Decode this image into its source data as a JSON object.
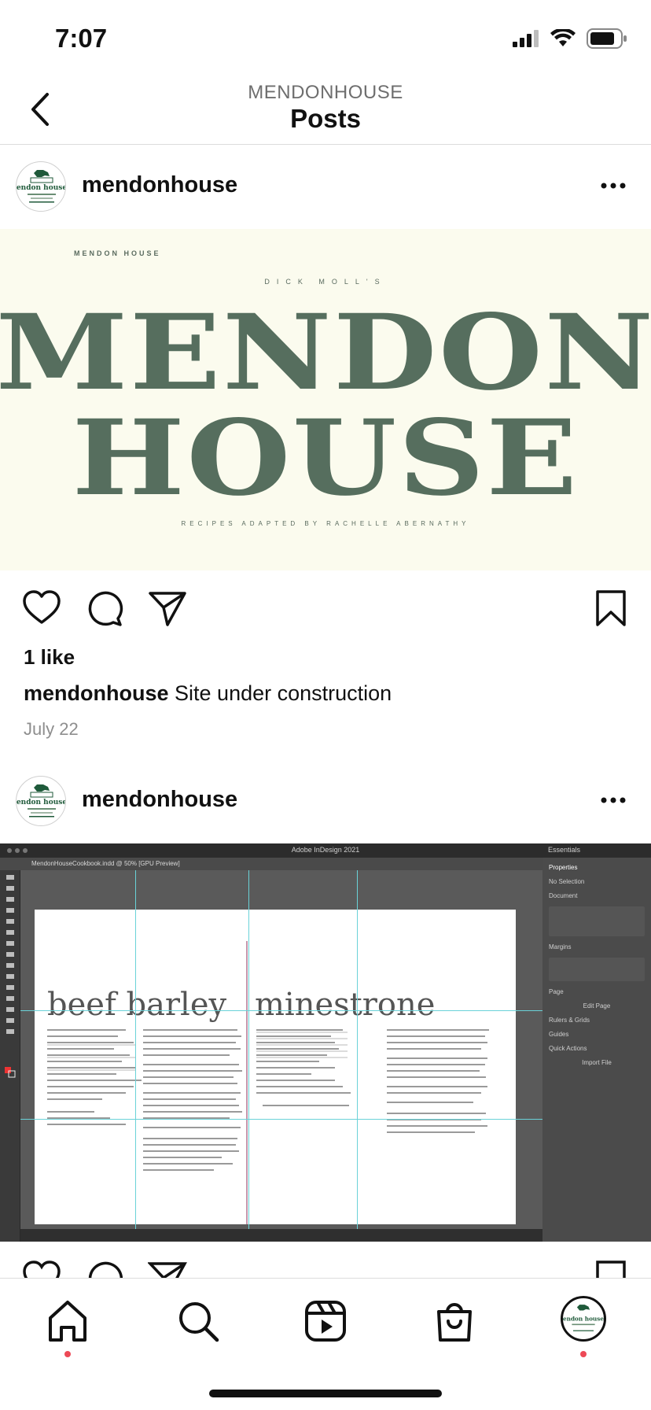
{
  "status_bar": {
    "time": "7:07"
  },
  "header": {
    "account": "MENDONHOUSE",
    "title": "Posts"
  },
  "posts": [
    {
      "username": "mendonhouse",
      "image": {
        "brand_small": "MENDON HOUSE",
        "subtitle_top": "DICK MOLL'S",
        "line1": "MENDON",
        "line2": "HOUSE",
        "subtitle_bottom": "RECIPES ADAPTED BY RACHELLE ABERNATHY"
      },
      "likes": "1 like",
      "caption_user": "mendonhouse",
      "caption_text": "Site under construction",
      "date": "July 22"
    },
    {
      "username": "mendonhouse",
      "image": {
        "app_title": "Adobe InDesign 2021",
        "tab": "MendonHouseCookbook.indd @ 50% [GPU Preview]",
        "left_heading": "beef barley",
        "right_heading": "minestrone",
        "panel_items": [
          "Properties",
          "No Selection",
          "Document",
          "Margins",
          "Page",
          "Edit Page",
          "Rulers & Grids",
          "Guides",
          "Quick Actions",
          "Import File"
        ],
        "workspace": "Essentials"
      }
    }
  ],
  "nav": {
    "items": [
      "home",
      "search",
      "reels",
      "shop",
      "profile"
    ]
  },
  "colors": {
    "brand_green": "#566e5e",
    "cream": "#fbfbee",
    "notification": "#ed4956"
  }
}
